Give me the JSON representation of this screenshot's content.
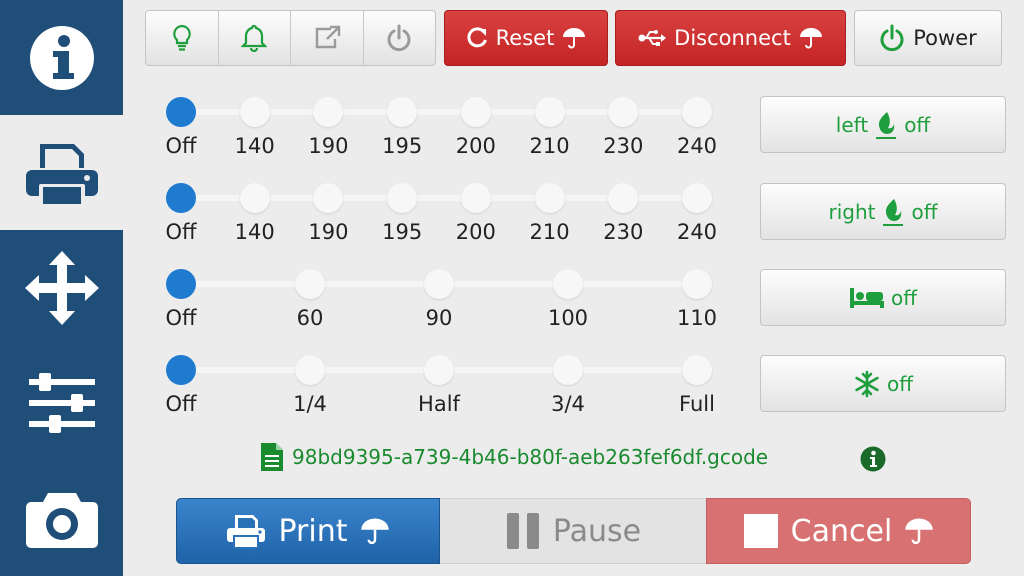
{
  "sidebar": {
    "items": [
      {
        "icon": "info-icon",
        "active": false
      },
      {
        "icon": "printer-icon",
        "active": true
      },
      {
        "icon": "move-arrows-icon",
        "active": false
      },
      {
        "icon": "sliders-icon",
        "active": false
      },
      {
        "icon": "camera-icon",
        "active": false
      }
    ]
  },
  "toolbar": {
    "icon_buttons": [
      "lightbulb-icon",
      "bell-icon",
      "external-link-icon",
      "power-icon"
    ],
    "reset_label": "Reset",
    "disconnect_label": "Disconnect",
    "power_label": "Power"
  },
  "sliders": [
    {
      "name": "left-extruder-temp",
      "labels": [
        "Off",
        "140",
        "190",
        "195",
        "200",
        "210",
        "230",
        "240"
      ],
      "selected": 0
    },
    {
      "name": "right-extruder-temp",
      "labels": [
        "Off",
        "140",
        "190",
        "195",
        "200",
        "210",
        "230",
        "240"
      ],
      "selected": 0
    },
    {
      "name": "bed-temp",
      "labels": [
        "Off",
        "60",
        "90",
        "100",
        "110"
      ],
      "selected": 0
    },
    {
      "name": "fan-speed",
      "labels": [
        "Off",
        "1/4",
        "Half",
        "3/4",
        "Full"
      ],
      "selected": 0
    }
  ],
  "toggles": {
    "left": {
      "prefix": "left",
      "state": "off",
      "icon": "flame-icon"
    },
    "right": {
      "prefix": "right",
      "state": "off",
      "icon": "flame-icon"
    },
    "bed": {
      "prefix": "",
      "state": "off",
      "icon": "bed-icon"
    },
    "fan": {
      "prefix": "",
      "state": "off",
      "icon": "snowflake-icon"
    }
  },
  "file": {
    "name": "98bd9395-a739-4b46-b80f-aeb263fef6df.gcode"
  },
  "controls": {
    "print_label": "Print",
    "pause_label": "Pause",
    "cancel_label": "Cancel"
  },
  "colors": {
    "accent": "#1f4e79",
    "danger": "#c42424",
    "success": "#1f9e3d",
    "selected": "#1f7bd0"
  }
}
